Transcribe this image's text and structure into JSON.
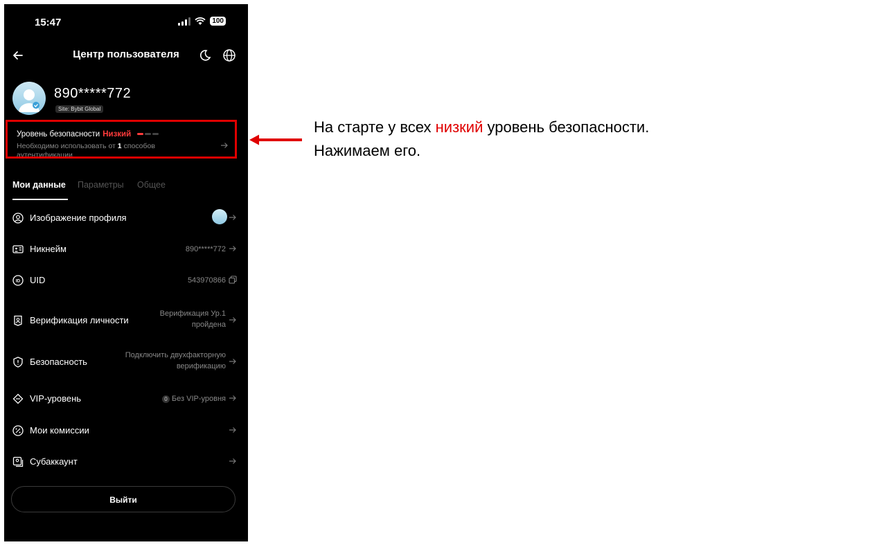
{
  "status_bar": {
    "time": "15:47",
    "battery": "100"
  },
  "header": {
    "title": "Центр пользователя"
  },
  "profile": {
    "phone": "890*****772",
    "site": "Site: Bybit Global"
  },
  "security": {
    "label": "Уровень безопасности",
    "level": "Низкий",
    "hint_prefix": "Необходимо использовать от ",
    "hint_count": "1",
    "hint_suffix": " способов аутентификации.",
    "level_filled": 1,
    "level_total": 3,
    "highlight_color": "#e00000"
  },
  "tabs": [
    {
      "label": "Мои данные",
      "active": true
    },
    {
      "label": "Параметры",
      "active": false
    },
    {
      "label": "Общее",
      "active": false
    }
  ],
  "rows": [
    {
      "label": "Изображение профиля",
      "value": "",
      "icon": "person-circle-icon"
    },
    {
      "label": "Никнейм",
      "value": "890*****772",
      "icon": "id-card-icon"
    },
    {
      "label": "UID",
      "value": "543970866",
      "icon": "id-badge-icon"
    },
    {
      "label": "Верификация личности",
      "value_line1": "Верификация Ур.1",
      "value_line2": "пройдена",
      "icon": "identity-shield-icon"
    },
    {
      "label": "Безопасность",
      "value_line1": "Подключить двухфакторную",
      "value_line2": "верификацию",
      "icon": "shield-icon"
    },
    {
      "label": "VIP-уровень",
      "value": "Без VIP-уровня",
      "badge": "0",
      "icon": "diamond-icon"
    },
    {
      "label": "Мои комиссии",
      "value": "",
      "icon": "percent-icon"
    },
    {
      "label": "Субаккаунт",
      "value": "",
      "icon": "subaccount-icon"
    }
  ],
  "logout": {
    "label": "Выйти"
  },
  "annotation": {
    "part1": "На старте у всех ",
    "highlight": "низкий",
    "part2": " уровень безопасности.",
    "line2": "Нажимаем его."
  }
}
